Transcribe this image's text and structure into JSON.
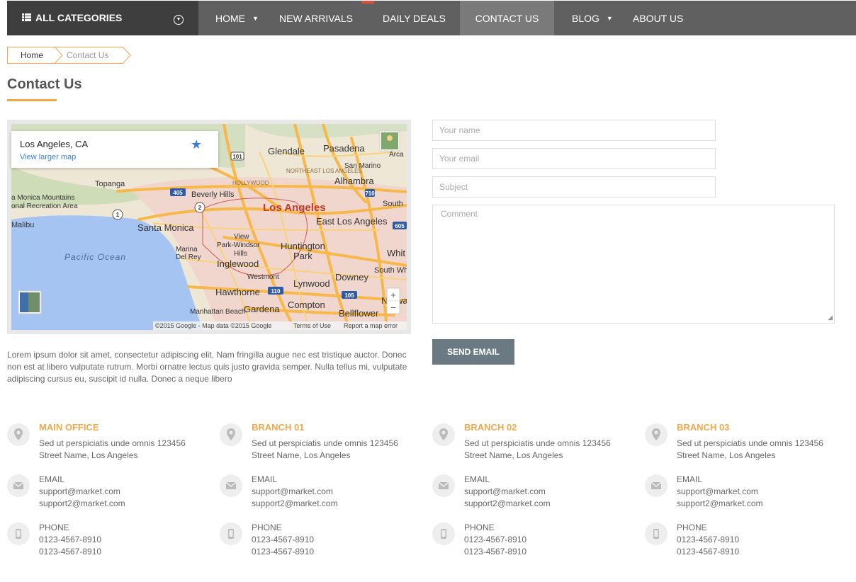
{
  "nav": {
    "all_categories": "ALL CATEGORIES",
    "items": [
      "HOME",
      "NEW ARRIVALS",
      "DAILY DEALS",
      "CONTACT US",
      "BLOG",
      "ABOUT US"
    ]
  },
  "breadcrumb": [
    "Home",
    "Contact Us"
  ],
  "page_title": "Contact Us",
  "map": {
    "city": "Los Angeles, CA",
    "larger_link": "View larger map",
    "copyright": "©2015 Google - Map data ©2015 Google",
    "terms": "Terms of Use",
    "report": "Report a map error",
    "zoom_in": "+",
    "zoom_out": "−",
    "labels": {
      "glendale": "Glendale",
      "pasadena": "Pasadena",
      "arcadia": "Arca",
      "san_marino": "San Marino",
      "northeast": "NORTHEAST LOS ANGELES",
      "hollywood": "HOLLYWOOD",
      "alhambra": "Alhambra",
      "topanga": "Topanga",
      "monica_mountains": "a Monica Mountains",
      "recreation": "onal Recreation Area",
      "beverly": "Beverly Hills",
      "los_angeles": "Los Angeles",
      "south": "South",
      "malibu": "Malibu",
      "santa_monica": "Santa Monica",
      "east_la": "East Los Angeles",
      "view": "View",
      "park_windsor": "Park-Windsor",
      "hills": "Hills",
      "huntington": "Huntington",
      "park": "Park",
      "whit": "Whit",
      "pacific": "Pacific Ocean",
      "marina": "Marina",
      "del_rey": "Del Rey",
      "inglewood": "Inglewood",
      "south_whit": "South Whit",
      "westmont": "Westmont",
      "downey": "Downey",
      "lynwood": "Lynwood",
      "hawthorne": "Hawthorne",
      "norwa": "Norwa",
      "gardena": "Gardena",
      "compton": "Compton",
      "manhattan": "Manhattan Beach",
      "bellflower": "Bellflower",
      "r101": "101",
      "r405": "405",
      "r710": "710",
      "r605": "605",
      "r2": "2",
      "r1": "1",
      "r110": "110",
      "r105": "105"
    }
  },
  "form": {
    "name_placeholder": "Your name",
    "email_placeholder": "Your email",
    "subject_placeholder": "Subject",
    "comment_placeholder": "Comment",
    "send_label": "SEND EMAIL"
  },
  "description": "Lorem ipsum dolor sit amet, consectetur adipiscing elit. Nam fringilla augue nec est tristique auctor. Donec non est at libero vulputate rutrum. Morbi ornatre lectus quis justo gravida semper. Nulla tellus mi, vulputate adipiscing cursus eu, suscipit id nulla. Donec a neque libero",
  "offices": [
    {
      "title": "MAIN OFFICE",
      "addr1": "Sed ut perspiciatis unde omnis 123456",
      "addr2": "Street Name, Los Angeles",
      "email_label": "EMAIL",
      "email1": "support@market.com",
      "email2": "support2@market.com",
      "phone_label": "PHONE",
      "phone1": "0123-4567-8910",
      "phone2": "0123-4567-8910"
    },
    {
      "title": "BRANCH 01",
      "addr1": "Sed ut perspiciatis unde omnis 123456",
      "addr2": "Street Name, Los Angeles",
      "email_label": "EMAIL",
      "email1": "support@market.com",
      "email2": "support2@market.com",
      "phone_label": "PHONE",
      "phone1": "0123-4567-8910",
      "phone2": "0123-4567-8910"
    },
    {
      "title": "BRANCH 02",
      "addr1": "Sed ut perspiciatis unde omnis 123456",
      "addr2": "Street Name, Los Angeles",
      "email_label": "EMAIL",
      "email1": "support@market.com",
      "email2": "support2@market.com",
      "phone_label": "PHONE",
      "phone1": "0123-4567-8910",
      "phone2": "0123-4567-8910"
    },
    {
      "title": "BRANCH 03",
      "addr1": "Sed ut perspiciatis unde omnis 123456",
      "addr2": "Street Name, Los Angeles",
      "email_label": "EMAIL",
      "email1": "support@market.com",
      "email2": "support2@market.com",
      "phone_label": "PHONE",
      "phone1": "0123-4567-8910",
      "phone2": "0123-4567-8910"
    }
  ],
  "colors": {
    "accent": "#f0a84d",
    "nav_bg": "#606060",
    "nav_dark": "#3e3e3e",
    "button": "#6b7a82"
  },
  "icons": [
    "list-icon",
    "chevron-circle-icon",
    "caret-down-icon",
    "star-icon",
    "location-pin-icon",
    "envelope-icon",
    "mobile-phone-icon"
  ]
}
